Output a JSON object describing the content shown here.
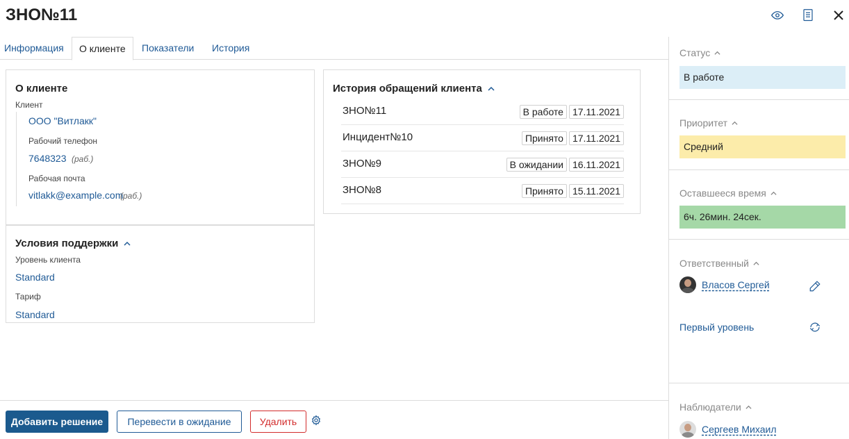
{
  "header": {
    "title": "ЗНО№11",
    "icons": [
      "eye-icon",
      "document-icon",
      "close-icon"
    ]
  },
  "tabs": [
    {
      "label": "Информация",
      "active": false
    },
    {
      "label": "О клиенте",
      "active": true
    },
    {
      "label": "Показатели",
      "active": false
    },
    {
      "label": "История",
      "active": false
    }
  ],
  "client_card": {
    "title": "О клиенте",
    "client_label": "Клиент",
    "client_name": "ООО \"Витлакк\"",
    "phone_label": "Рабочий телефон",
    "phone_value": "7648323",
    "phone_tag": "(раб.)",
    "email_label": "Рабочая почта",
    "email_value": "vitlakk@example.com",
    "email_tag": "(раб.)"
  },
  "support_card": {
    "title": "Условия поддержки",
    "level_label": "Уровень клиента",
    "level_value": "Standard",
    "tariff_label": "Тариф",
    "tariff_value": "Standard"
  },
  "history_card": {
    "title": "История обращений клиента",
    "rows": [
      {
        "name": "ЗНО№11",
        "status": "В работе",
        "date": "17.11.2021"
      },
      {
        "name": "Инцидент№10",
        "status": "Принято",
        "date": "17.11.2021"
      },
      {
        "name": "ЗНО№9",
        "status": "В ожидании",
        "date": "16.11.2021"
      },
      {
        "name": "ЗНО№8",
        "status": "Принято",
        "date": "15.11.2021"
      }
    ]
  },
  "actions": {
    "add_solution": "Добавить решение",
    "to_waiting": "Перевести в ожидание",
    "delete": "Удалить"
  },
  "sidebar": {
    "status_label": "Статус",
    "status_value": "В работе",
    "status_color": "#dceef7",
    "priority_label": "Приоритет",
    "priority_value": "Средний",
    "priority_color": "#fcecaa",
    "time_label": "Оставшееся время",
    "time_value": "6ч. 26мин. 24сек.",
    "time_color": "#a5d8a7",
    "responsible_label": "Ответственный",
    "responsible_name": "Власов Сергей",
    "support_level": "Первый уровень",
    "observers_label": "Наблюдатели",
    "observer_name": "Сергеев Михаил"
  }
}
